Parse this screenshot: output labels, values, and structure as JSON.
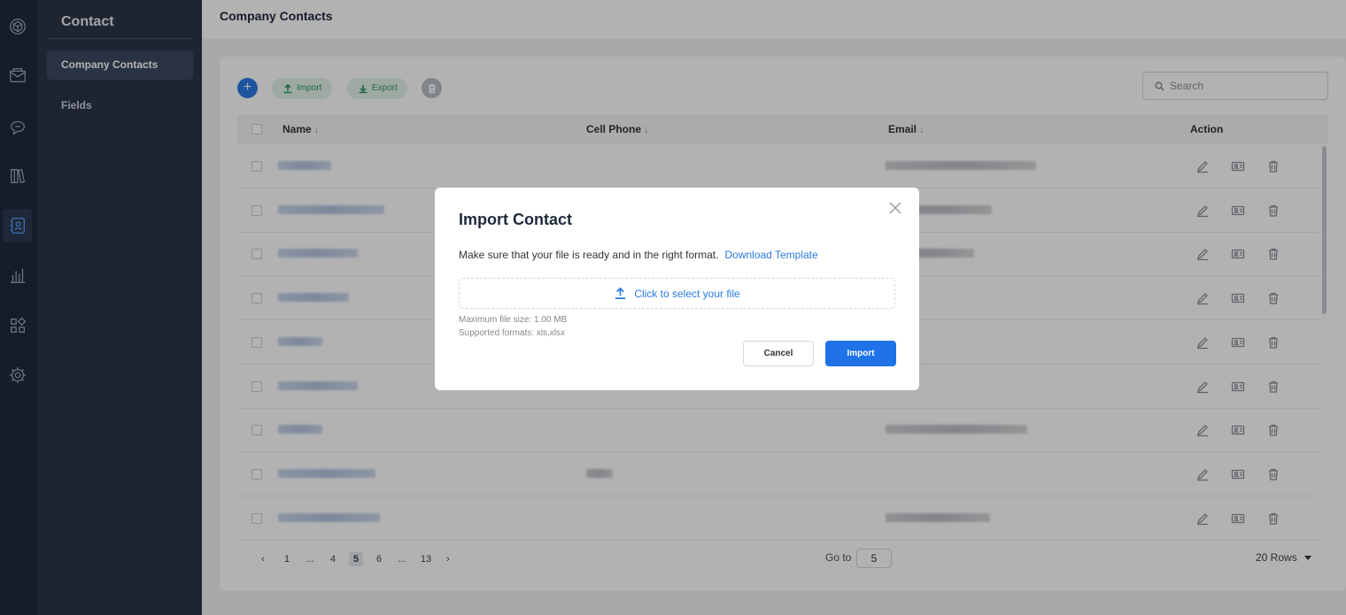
{
  "nav_rail": {
    "icons": [
      "logo-cube-icon",
      "mail-icon",
      "chat-bubble-icon",
      "book-icon",
      "contact-card-icon",
      "bar-chart-icon",
      "apps-grid-icon",
      "gear-icon"
    ],
    "active": "contact-card-icon"
  },
  "subnav": {
    "title": "Contact",
    "items": [
      {
        "label": "Company Contacts",
        "active": true
      },
      {
        "label": "Fields",
        "active": false
      }
    ]
  },
  "header": {
    "title": "Company Contacts"
  },
  "toolbar": {
    "add_icon": "plus-icon",
    "import_label": "Import",
    "export_label": "Export",
    "delete_icon": "trash-icon"
  },
  "search": {
    "placeholder": "Search"
  },
  "table": {
    "columns": [
      {
        "label": "Name",
        "sortable": true
      },
      {
        "label": "Cell Phone",
        "sortable": true
      },
      {
        "label": "Email",
        "sortable": true
      },
      {
        "label": "Action",
        "sortable": false
      }
    ],
    "sort_arrow": "↓",
    "row_count_visible": 9,
    "row_actions": [
      "edit-icon",
      "contact-card-icon",
      "trash-icon"
    ]
  },
  "pagination": {
    "pages": [
      "1",
      "...",
      "4",
      "5",
      "6",
      "...",
      "13"
    ],
    "current": "5",
    "goto_label": "Go to",
    "goto_value": "5",
    "rows_label": "20 Rows"
  },
  "modal": {
    "title": "Import Contact",
    "description": "Make sure that your file is ready and in the right format.",
    "template_link": "Download Template",
    "dropzone_label": "Click to select your file",
    "max_size": "Maximum file size: 1.00 MB",
    "formats": "Supported formats: xls,xlsx",
    "cancel_label": "Cancel",
    "import_label": "Import",
    "accent": "#1f72e8"
  }
}
